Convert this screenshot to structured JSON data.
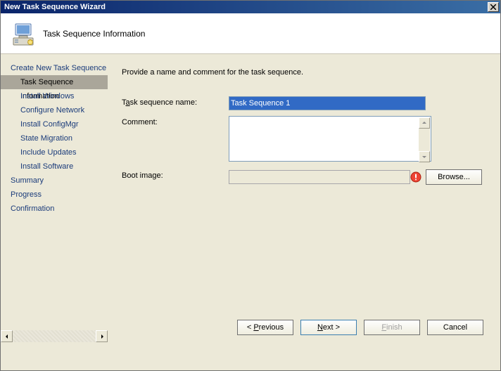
{
  "title": "New Task Sequence Wizard",
  "banner": {
    "title": "Task Sequence Information"
  },
  "sidebar": {
    "items": [
      {
        "label": "Create New Task Sequence",
        "level": 0
      },
      {
        "label": "Task Sequence Information",
        "level": 1,
        "selected": true
      },
      {
        "label": "Install Windows",
        "level": 1
      },
      {
        "label": "Configure Network",
        "level": 1
      },
      {
        "label": "Install ConfigMgr",
        "level": 1
      },
      {
        "label": "State Migration",
        "level": 1
      },
      {
        "label": "Include Updates",
        "level": 1
      },
      {
        "label": "Install Software",
        "level": 1
      },
      {
        "label": "Summary",
        "level": 0
      },
      {
        "label": "Progress",
        "level": 0
      },
      {
        "label": "Confirmation",
        "level": 0
      }
    ]
  },
  "content": {
    "instruction": "Provide a name and comment for the task sequence.",
    "name_label_pre": "T",
    "name_label_hot": "a",
    "name_label_post": "sk sequence name:",
    "name_value": "Task Sequence 1",
    "comment_label": "Comment:",
    "comment_value": "",
    "boot_label": "Boot image:",
    "boot_value": "",
    "browse_label_pre": "B",
    "browse_label_hot": "r",
    "browse_label_post": "owse..."
  },
  "footer": {
    "prev_pre": "< ",
    "prev_hot": "P",
    "prev_post": "revious",
    "next_pre": "",
    "next_hot": "N",
    "next_post": "ext >",
    "finish_pre": "",
    "finish_hot": "F",
    "finish_post": "inish",
    "cancel": "Cancel"
  }
}
